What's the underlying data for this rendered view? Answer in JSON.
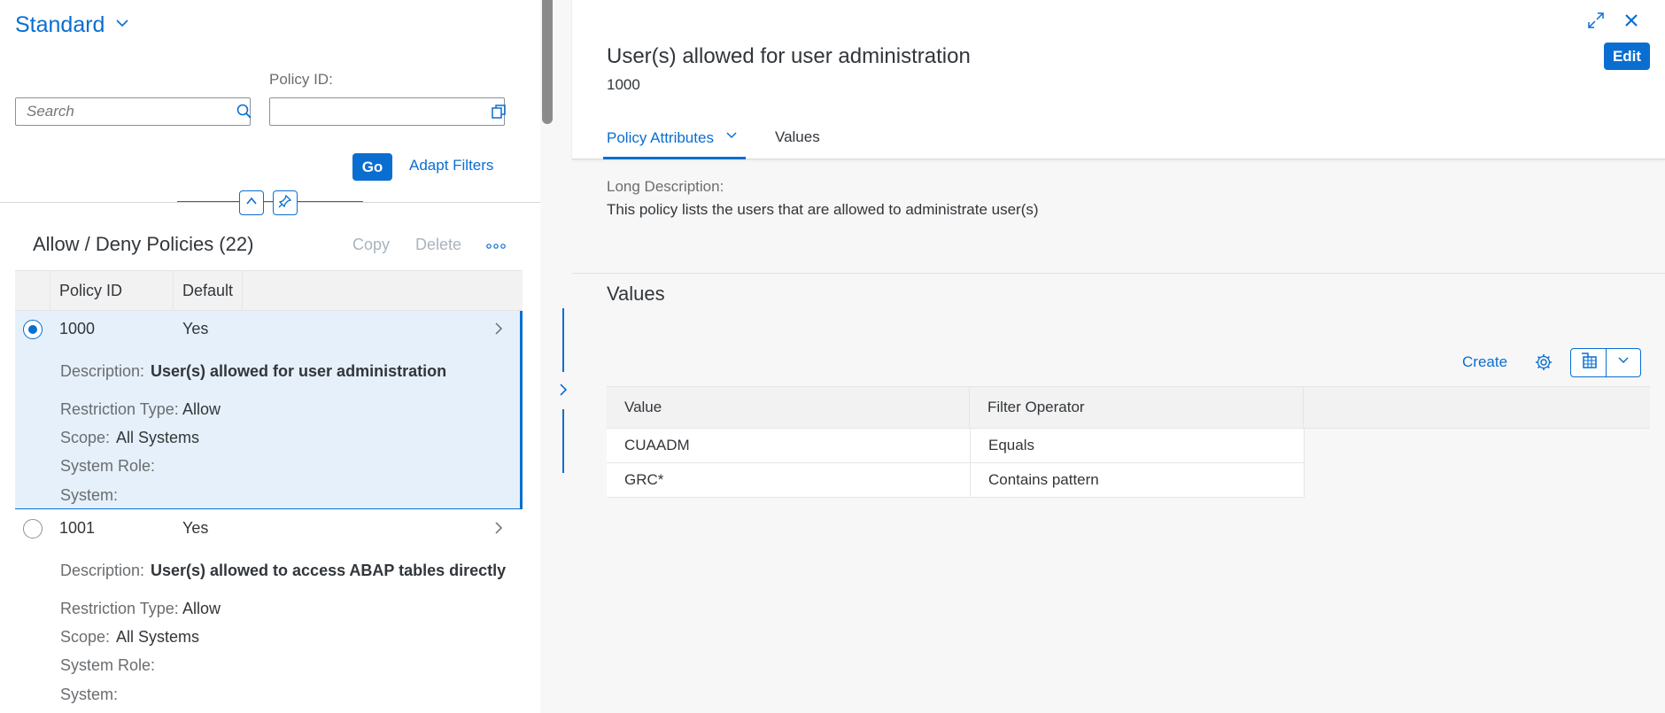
{
  "filterbar": {
    "variant_title": "Standard",
    "search_placeholder": "Search",
    "policy_id_label": "Policy ID:",
    "policy_id_value": "",
    "go_label": "Go",
    "adapt_filters_label": "Adapt Filters"
  },
  "list": {
    "title": "Allow / Deny Policies (22)",
    "copy_label": "Copy",
    "delete_label": "Delete",
    "columns": [
      "Policy ID",
      "Default"
    ],
    "rows": [
      {
        "policy_id": "1000",
        "default": "Yes",
        "description_label": "Description:",
        "description": "User(s) allowed for user administration",
        "restriction_label": "Restriction Type:",
        "restriction": "Allow",
        "scope_label": "Scope:",
        "scope": "All Systems",
        "system_role_label": "System Role:",
        "system_label": "System:"
      },
      {
        "policy_id": "1001",
        "default": "Yes",
        "description_label": "Description:",
        "description": "User(s) allowed to access ABAP tables directly",
        "restriction_label": "Restriction Type:",
        "restriction": "Allow",
        "scope_label": "Scope:",
        "scope": "All Systems",
        "system_role_label": "System Role:",
        "system_label": "System:"
      }
    ]
  },
  "detail": {
    "title": "User(s) allowed for user administration",
    "subtitle": "1000",
    "edit_label": "Edit",
    "tabs": [
      {
        "label": "Policy Attributes"
      },
      {
        "label": "Values"
      }
    ],
    "long_description_label": "Long Description:",
    "long_description": "This policy lists the users that are allowed to administrate user(s)",
    "values_section_title": "Values",
    "create_label": "Create",
    "values_table": {
      "columns": [
        "Value",
        "Filter Operator"
      ],
      "rows": [
        {
          "value": "CUAADM",
          "operator": "Equals"
        },
        {
          "value": "GRC*",
          "operator": "Contains pattern"
        }
      ]
    }
  },
  "colors": {
    "accent": "#0a6ed1",
    "selected_row": "#e5f0fa",
    "header_bg": "#f2f2f2",
    "text": "#32363a",
    "label": "#6a6d70"
  },
  "icons": [
    "chevron-down-icon",
    "search-icon",
    "value-help-icon",
    "collapse-up-icon",
    "pin-icon",
    "overflow-icon",
    "chevron-right-icon",
    "exit-fullscreen-icon",
    "close-icon",
    "settings-icon",
    "export-icon"
  ]
}
